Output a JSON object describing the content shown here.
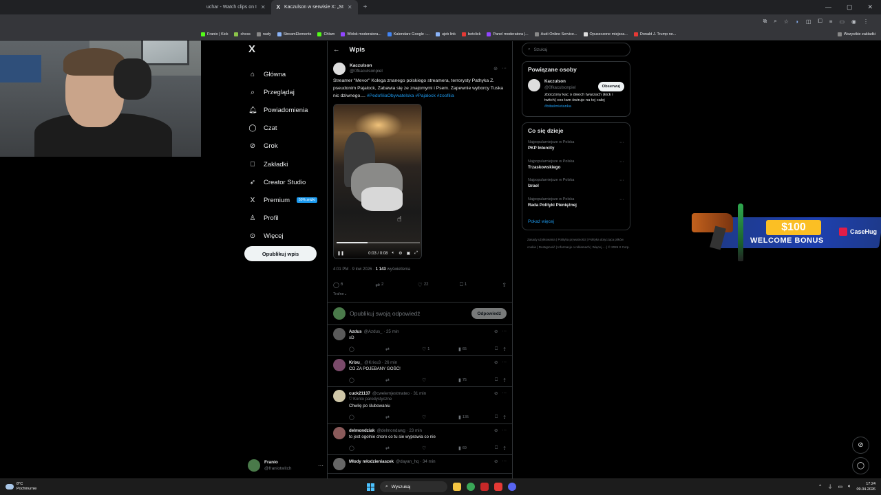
{
  "browser": {
    "tabs": [
      {
        "title": "uchar - Watch clips on I",
        "active": false
      },
      {
        "title": "Kaczulson w serwisie X: „St",
        "active": true
      }
    ],
    "bookmarks": [
      "Franio | Kick",
      "chess",
      "nudy",
      "StreamElements",
      "Chłam",
      "Widok moderatora...",
      "Kalendarz Google -...",
      "ujeb link",
      "betclick",
      "Panel moderatora |...",
      "Audi Online Service...",
      "Opuszczone miejsca...",
      "Donald J. Trump ne..."
    ],
    "all_bookmarks": "Wszystkie zakładki"
  },
  "nav": {
    "logo": "X",
    "items": [
      {
        "label": "Główna",
        "icon": "home-icon",
        "glyph": "⌂"
      },
      {
        "label": "Przeglądaj",
        "icon": "search-icon",
        "glyph": "⌕"
      },
      {
        "label": "Powiadomienia",
        "icon": "bell-icon",
        "glyph": "🔔︎"
      },
      {
        "label": "Czat",
        "icon": "chat-icon",
        "glyph": "◯"
      },
      {
        "label": "Grok",
        "icon": "grok-icon",
        "glyph": "⊘"
      },
      {
        "label": "Zakładki",
        "icon": "bookmark-icon",
        "glyph": "⎕"
      },
      {
        "label": "Creator Studio",
        "icon": "rocket-icon",
        "glyph": "➶"
      },
      {
        "label": "Premium",
        "icon": "x-premium-icon",
        "glyph": "X"
      },
      {
        "label": "Profil",
        "icon": "profile-icon",
        "glyph": "♙"
      },
      {
        "label": "Więcej",
        "icon": "more-circle-icon",
        "glyph": "⊙"
      }
    ],
    "premium_badge": "50% zniżki",
    "post_button": "Opublikuj wpis",
    "account": {
      "name": "Franio",
      "handle": "@franiotwitch"
    }
  },
  "main": {
    "back_glyph": "←",
    "title": "Wpis",
    "tweet": {
      "name": "Kaczulson",
      "handle": "@0fkaculsonpiel",
      "text": "Streamer \"Mevor\" Kolega znanego polskiego streamera, terrorysty Pathyka Z. pseudonim Pajalock, Zabawia się ze znajomymi i Psem. Zapewnie wyborcy Tuska nic dziwnego....",
      "tags": [
        "#PedofiliaObywatelska",
        "#Pajalock",
        "#zoofilia"
      ],
      "video_time": "0:03 / 0:08",
      "video_progress": 0.375,
      "timestamp": "4:01 PM · 9 kwi 2026 ·",
      "views_count": "1 143",
      "views_label": "wyświetlenia",
      "replies": "6",
      "reposts": "2",
      "likes": "22",
      "bookmarks": "1",
      "sort": "Trafne⌄"
    },
    "reply_box": {
      "placeholder": "Opublikuj swoją odpowiedź",
      "button": "Odpowiedź"
    },
    "replies": [
      {
        "name": "Azdus",
        "handle": "@Azdus_ · 25 min",
        "text": "xD",
        "sub": "",
        "likes": "1",
        "views": "65"
      },
      {
        "name": "Krixu_",
        "handle": "@Krixu3 · 26 min",
        "text": "CO ZA POJEBANY GOŚĆ!",
        "sub": "",
        "likes": "",
        "views": "75"
      },
      {
        "name": "cuck21137",
        "handle": "@cwelemjestmateo · 31 min",
        "text": "Chwilę po ślubowaniu",
        "sub": "Konto parodystyczne",
        "likes": "",
        "views": "135"
      },
      {
        "name": "delmondziak",
        "handle": "@delmondawg · 23 min",
        "text": "to jest ogolnie chore co tu sie wyprawia co nie",
        "sub": "",
        "likes": "",
        "views": "69"
      },
      {
        "name": "Młody młodzieniaszek",
        "handle": "@dayan_hq · 34 min",
        "text": "",
        "sub": "",
        "likes": "",
        "views": ""
      }
    ]
  },
  "right": {
    "search_placeholder": "Szukaj",
    "related": {
      "title": "Powiązane osoby",
      "name": "Kaczulson",
      "handle": "@0fkaculsonpiel",
      "bio": "zboczony kac o dwoch twarzach (kick i twitch) cos tam świruje na tej całej",
      "bio_tag": "#bitaśmietanka",
      "follow": "Obserwuj"
    },
    "trends": {
      "title": "Co się dzieje",
      "items": [
        {
          "context": "Najpopularniejsze w Polska",
          "name": "PKP Intercity"
        },
        {
          "context": "Najpopularniejsze w Polska",
          "name": "Trzaskowskiego"
        },
        {
          "context": "Najpopularniejsze w Polska",
          "name": "Izrael"
        },
        {
          "context": "Najpopularniejsze w Polska",
          "name": "Rada Polityki Pieniężnej"
        }
      ],
      "show_more": "Pokaż więcej"
    },
    "footer": [
      "Zasady użytkowania",
      "Polityka prywatności",
      "Polityka dotycząca plików cookie",
      "Dostępność",
      "Informacje o reklamach",
      "Więcej ···",
      "© 2026 X Corp."
    ]
  },
  "banner": {
    "amount": "$100",
    "subtitle": "WELCOME BONUS",
    "brand": "CaseHug"
  },
  "taskbar": {
    "weather_temp": "8°C",
    "weather_desc": "Pochmurnie",
    "search": "Wyszukaj",
    "time": "17:24",
    "date": "09.04.2026"
  }
}
